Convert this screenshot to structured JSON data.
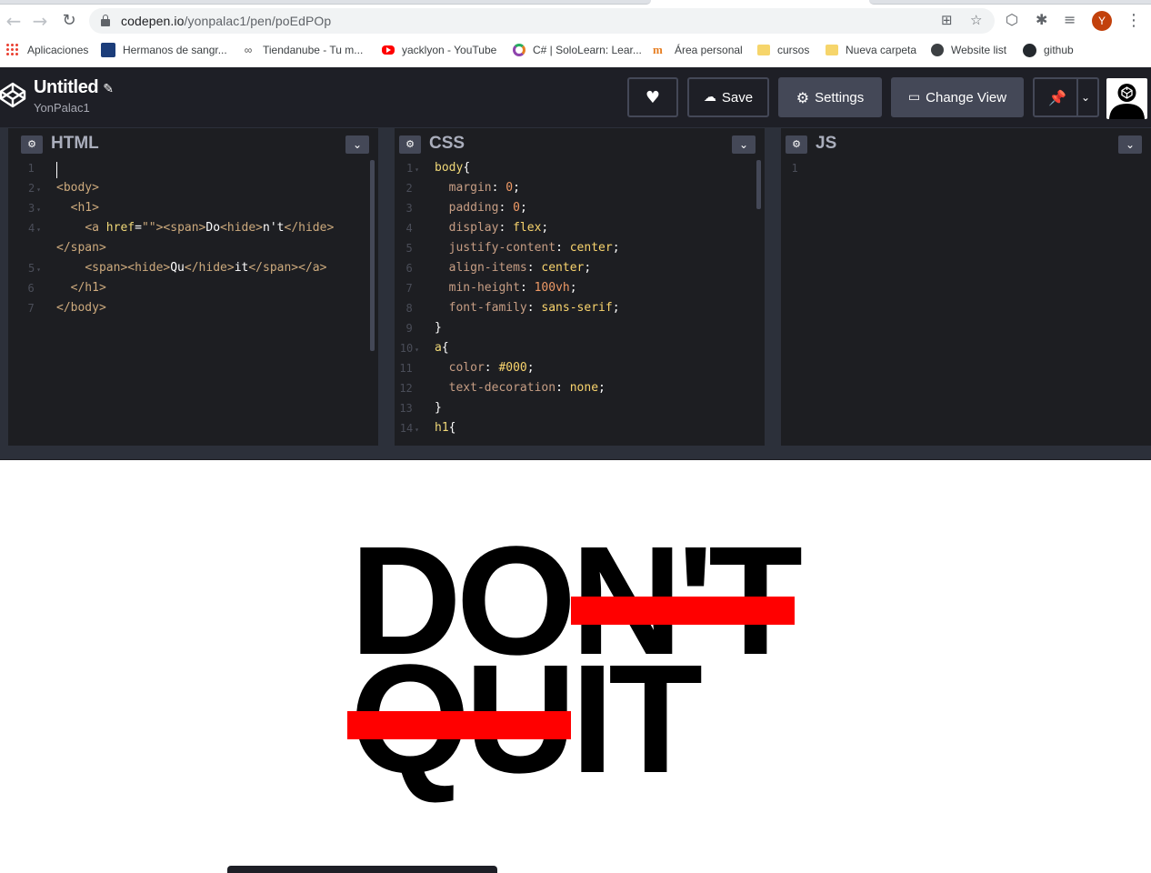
{
  "browser": {
    "url_host": "codepen.io",
    "url_path": "/yonpalac1/pen/poEdPOp",
    "profile_initial": "Y",
    "bookmarks": [
      {
        "label": "Aplicaciones",
        "icon": "apps-grid-icon"
      },
      {
        "label": "Hermanos de sangr...",
        "icon": "fa-icon"
      },
      {
        "label": "Tiendanube - Tu m...",
        "icon": "tiendanube-icon"
      },
      {
        "label": "yacklyon - YouTube",
        "icon": "youtube-icon"
      },
      {
        "label": "C# | SoloLearn: Lear...",
        "icon": "sololearn-icon"
      },
      {
        "label": "Área personal",
        "icon": "moodle-icon"
      },
      {
        "label": "cursos",
        "icon": "folder-icon"
      },
      {
        "label": "Nueva carpeta",
        "icon": "folder-icon"
      },
      {
        "label": "Website list",
        "icon": "globe-icon"
      },
      {
        "label": "github",
        "icon": "github-icon"
      }
    ]
  },
  "codepen": {
    "title": "Untitled",
    "user": "YonPalac1",
    "buttons": {
      "save": "Save",
      "settings": "Settings",
      "change_view": "Change View"
    }
  },
  "panes": {
    "html": {
      "title": "HTML"
    },
    "css": {
      "title": "CSS"
    },
    "js": {
      "title": "JS"
    }
  },
  "preview": {
    "word1_main": "DO",
    "word1_struck": "N'T",
    "word2_struck": "QU",
    "word2_main": "IT"
  }
}
